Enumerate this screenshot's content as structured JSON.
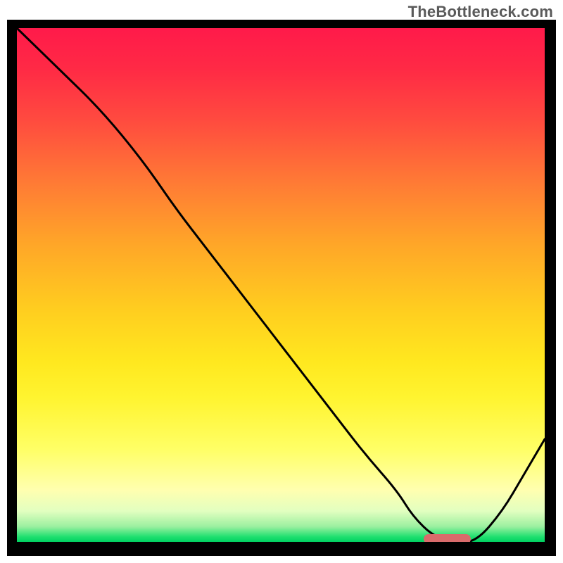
{
  "watermark": {
    "text": "TheBottleneck.com"
  },
  "chart_data": {
    "type": "line",
    "title": "",
    "xlabel": "",
    "ylabel": "",
    "xlim": [
      0,
      100
    ],
    "ylim": [
      0,
      100
    ],
    "grid": false,
    "series": [
      {
        "name": "curve",
        "x": [
          0,
          8,
          16,
          24,
          30,
          36,
          42,
          48,
          54,
          60,
          66,
          72,
          75,
          79,
          83,
          87,
          92,
          96,
          100
        ],
        "y": [
          100,
          92,
          84,
          74,
          65,
          57,
          49,
          41,
          33,
          25,
          17,
          10,
          5,
          1,
          0,
          0,
          6,
          13,
          20
        ]
      }
    ],
    "marker": {
      "x_start": 77,
      "x_end": 86,
      "y": 0.5,
      "color": "#d96b6b"
    },
    "background_gradient": {
      "top": "#ff1a4a",
      "bottom": "#00d060"
    }
  }
}
